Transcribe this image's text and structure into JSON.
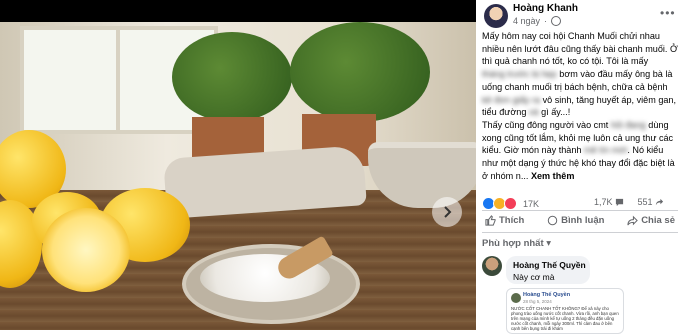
{
  "post": {
    "author": "Hoàng Khanh",
    "time": "4 ngày",
    "text_1": "Mấy hôm nay coi hội Chanh Muối chửi nhau nhiều nên lướt đâu cũng thấy bài chanh muối. Ở thì quả chanh nó tốt, ko có tội. Tôi là mấy",
    "blurred_1": "tháng trước bị hẹp",
    "text_2": "bơm vào đầu mấy ông bà là uống chanh muối trị bách bệnh, chữa cả bệnh",
    "blurred_2": "kê đơn giấy ra",
    "text_3": "vô sinh, tăng huyết áp, viêm gan, tiểu đường",
    "blurred_3": "và",
    "text_4": "gì ấy...!",
    "text_5": "Thấy cũng đông người vào cmt",
    "blurred_5": "hỏi đang",
    "text_6": "dùng xong cũng tốt lắm, khỏi mẹ luôn cả ung thư các kiểu. Giờ món này thành",
    "blurred_6": "mê tín mới",
    "text_7": ". Nó kiểu như một dạng ý thức hệ khó thay đổi đặc biệt là ở nhóm n...",
    "see_more": "Xem thêm"
  },
  "stats": {
    "reactions": "17K",
    "comments": "1,7K",
    "shares": "551"
  },
  "actions": {
    "like": "Thích",
    "comment": "Bình luận",
    "share": "Chia sẻ"
  },
  "comments_sort": "Phù hợp nhất",
  "comment": {
    "author": "Hoàng Thế Quyền",
    "text": "Này cơ mà",
    "attachment": {
      "author": "Hoàng Thế Quyền",
      "date": "28 thg 5, 2024",
      "body": "NƯỚC CỐT CHANH TỐT KHÔNG? Để xả này cho phong trào uống nước cốt chanh. Vừa rồi, anh bạn quen trên mạng của mình kể tự uống 2 tháng đều đặn uống nước cốt chanh, mỗi ngày 300ml. Thì cảm đau ở bên cạnh bên bụng trái đi khám"
    }
  },
  "colors": {
    "accent": "#1877f2",
    "secondary_text": "#65676b",
    "comment_bg": "#f0f2f5"
  }
}
